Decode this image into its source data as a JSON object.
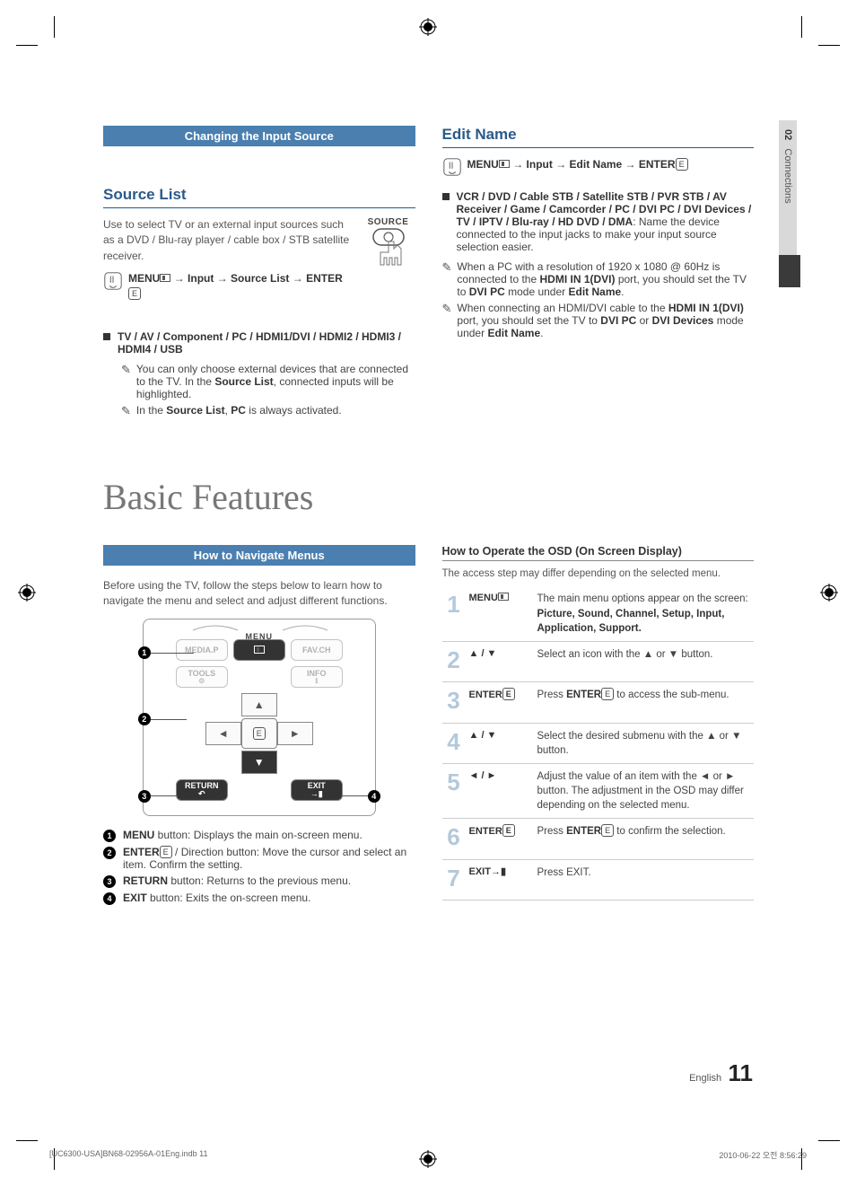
{
  "section_tab": {
    "num": "02",
    "label": "Connections"
  },
  "left": {
    "banner": "Changing the Input Source",
    "h1": "Source List",
    "intro": "Use to select TV or an external input sources such as a DVD / Blu-ray player / cable box / STB satellite receiver.",
    "source_label": "SOURCE",
    "path_prefix": "MENU",
    "path_items": "→ Input → Source List → ENTER",
    "sources_bold": "TV / AV / Component / PC / HDMI1/DVI / HDMI2 / HDMI3 / HDMI4 / USB",
    "note1_a": "You can only choose external devices that are connected to the TV. In the ",
    "note1_b": "Source List",
    "note1_c": ", connected inputs will be highlighted.",
    "note2_a": "In the ",
    "note2_b": "Source List",
    "note2_c": ", ",
    "note2_d": "PC",
    "note2_e": " is always activated."
  },
  "right": {
    "h1": "Edit Name",
    "path_prefix": "MENU",
    "path_items": "→ Input → Edit Name → ENTER",
    "bullet_bold": "VCR / DVD / Cable STB / Satellite STB / PVR STB / AV Receiver / Game / Camcorder / PC / DVI PC / DVI Devices / TV / IPTV / Blu-ray / HD DVD / DMA",
    "bullet_tail": ": Name the device connected to the input jacks to make your input source selection easier.",
    "note1_a": "When a PC with a resolution of 1920 x 1080 @ 60Hz is connected to the ",
    "note1_b": "HDMI IN 1(DVI)",
    "note1_c": " port, you should set the TV to ",
    "note1_d": "DVI PC",
    "note1_e": " mode under ",
    "note1_f": "Edit Name",
    "note1_g": ".",
    "note2_a": "When connecting an HDMI/DVI cable to the ",
    "note2_b": "HDMI IN 1(DVI)",
    "note2_c": " port, you should set the TV to ",
    "note2_d": "DVI PC",
    "note2_e": " or ",
    "note2_f": "DVI Devices",
    "note2_g": " mode under ",
    "note2_h": "Edit Name",
    "note2_i": "."
  },
  "basic": {
    "title": "Basic Features",
    "banner": "How to Navigate Menus",
    "intro": "Before using the TV, follow the steps below to learn how to navigate the menu and select and adjust different functions.",
    "remote": {
      "menu_label": "MENU",
      "media_p": "MEDIA.P",
      "fav_ch": "FAV.CH",
      "tools": "TOOLS",
      "info": "INFO",
      "return": "RETURN",
      "exit": "EXIT"
    },
    "legend": {
      "1_a": "MENU",
      "1_b": " button: Displays the main on-screen menu.",
      "2_a": "ENTER",
      "2_b": " / Direction button: Move the cursor and select an item. Confirm the setting.",
      "3_a": "RETURN",
      "3_b": " button: Returns to the previous menu.",
      "4_a": "EXIT",
      "4_b": " button: Exits the on-screen menu."
    },
    "osd_h": "How to Operate the OSD (On Screen Display)",
    "osd_sub": "The access step may differ depending on the selected menu.",
    "osd": [
      {
        "n": "1",
        "key": "MENU",
        "desc_a": "The main menu options appear on the screen:",
        "desc_b": "Picture, Sound, Channel, Setup, Input, Application, Support."
      },
      {
        "n": "2",
        "key": "▲ / ▼",
        "desc": "Select an icon with the ▲ or ▼ button."
      },
      {
        "n": "3",
        "key": "ENTER",
        "desc": "Press ENTER E to access the sub-menu."
      },
      {
        "n": "4",
        "key": "▲ / ▼",
        "desc": "Select the desired submenu with the ▲ or ▼ button."
      },
      {
        "n": "5",
        "key": "◄ / ►",
        "desc": "Adjust the value of an item with the ◄ or ► button. The adjustment in the OSD may differ depending on the selected menu."
      },
      {
        "n": "6",
        "key": "ENTER",
        "desc": "Press ENTER E to confirm the selection."
      },
      {
        "n": "7",
        "key": "EXIT",
        "desc": "Press EXIT."
      }
    ]
  },
  "footer": {
    "lang": "English",
    "page": "11"
  },
  "print": {
    "file": "[UC6300-USA]BN68-02956A-01Eng.indb   11",
    "date": "2010-06-22   오전 8:56:29"
  }
}
